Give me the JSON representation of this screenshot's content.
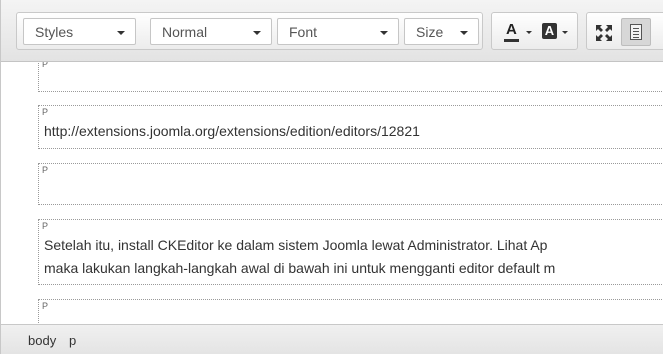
{
  "toolbar": {
    "styles_label": "Styles",
    "format_label": "Normal",
    "font_label": "Font",
    "size_label": "Size",
    "text_color_glyph": "A",
    "bg_color_glyph": "A"
  },
  "content": {
    "block_tag": "P",
    "paragraphs": [
      "",
      "http://extensions.joomla.org/extensions/edition/editors/12821",
      "",
      "Setelah itu, install CKEditor ke dalam sistem Joomla lewat Administrator. Lihat Ap",
      "maka lakukan langkah-langkah awal di bawah ini untuk mengganti editor default m",
      ""
    ]
  },
  "statusbar": {
    "path": [
      "body",
      "p"
    ]
  }
}
